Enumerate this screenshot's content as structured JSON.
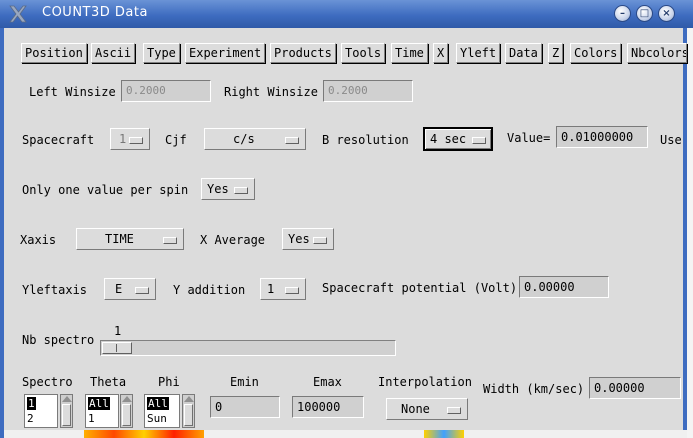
{
  "window": {
    "title": "COUNT3D Data"
  },
  "menubar": {
    "items": [
      "Position",
      "Ascii",
      "Type",
      "Experiment",
      "Products",
      "Tools",
      "Time",
      "X",
      "Yleft",
      "Data",
      "Z",
      "Colors",
      "Nbcolors"
    ]
  },
  "winsize": {
    "left_label": "Left Winsize",
    "left_value": "0.2000",
    "right_label": "Right Winsize",
    "right_value": "0.2000"
  },
  "spacecraft": {
    "label": "Spacecraft",
    "value": "1",
    "cjf_label": "Cjf",
    "cjf_value": "c/s",
    "bres_label": "B resolution",
    "bres_value": "4 sec",
    "value_label": "Value=",
    "value_value": "0.01000000",
    "use_label": "Use"
  },
  "spin": {
    "label": "Only one value per spin",
    "value": "Yes"
  },
  "xaxis": {
    "label": "Xaxis",
    "value": "TIME",
    "avg_label": "X Average",
    "avg_value": "Yes"
  },
  "yleft": {
    "label": "Yleftaxis",
    "value": "E",
    "add_label": "Y addition",
    "add_value": "1",
    "pot_label": "Spacecraft potential (Volt)",
    "pot_value": "0.00000"
  },
  "nbspectro": {
    "label": "Nb spectro",
    "value": "1",
    "fraction": 0.0
  },
  "bottom": {
    "spectro_label": "Spectro",
    "spectro_selected": "1",
    "spectro_next": "2",
    "theta_label": "Theta",
    "theta_selected": "All",
    "theta_next": "1",
    "phi_label": "Phi",
    "phi_selected": "All",
    "phi_next": "Sun",
    "emin_label": "Emin",
    "emin_value": "0",
    "emax_label": "Emax",
    "emax_value": "100000",
    "interp_label": "Interpolation",
    "interp_value": "None",
    "width_label": "Width (km/sec)",
    "width_value": "0.00000"
  }
}
